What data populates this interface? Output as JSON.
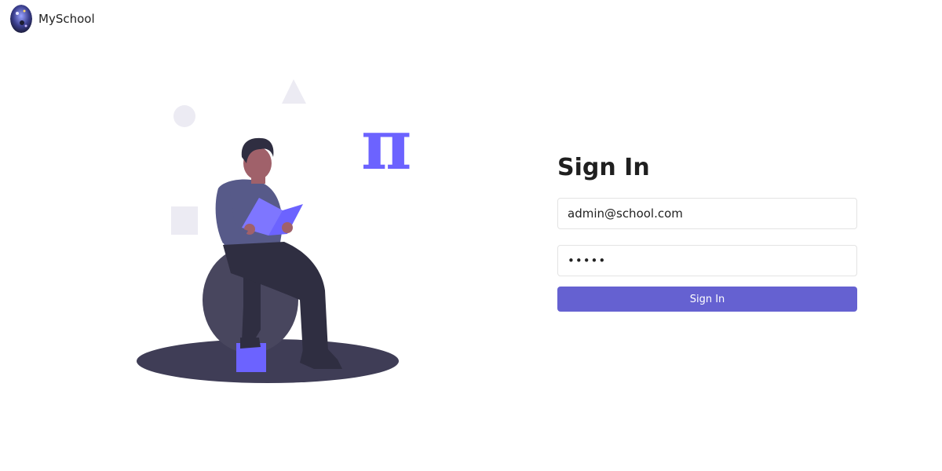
{
  "app": {
    "name": "MySchool"
  },
  "signin": {
    "title": "Sign In",
    "email_value": "admin@school.com",
    "password_value": "•••••",
    "button_label": "Sign In"
  },
  "illustration": {
    "glyph": "π"
  },
  "colors": {
    "accent": "#6561d1",
    "illustration_purple": "#6c63ff",
    "dark_shape": "#3f3d56"
  }
}
